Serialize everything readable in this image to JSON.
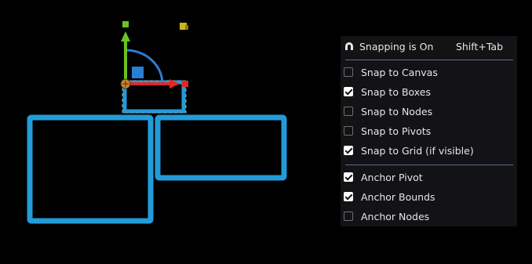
{
  "snap_menu": {
    "title": "Snapping is On",
    "shortcut": "Shift+Tab",
    "snap_items": [
      {
        "label": "Snap to Canvas",
        "checked": false
      },
      {
        "label": "Snap to Boxes",
        "checked": true
      },
      {
        "label": "Snap to Nodes",
        "checked": false
      },
      {
        "label": "Snap to Pivots",
        "checked": false
      },
      {
        "label": "Snap to Grid (if visible)",
        "checked": true
      }
    ],
    "anchor_items": [
      {
        "label": "Anchor Pivot",
        "checked": true
      },
      {
        "label": "Anchor Bounds",
        "checked": true
      },
      {
        "label": "Anchor Nodes",
        "checked": false
      }
    ]
  },
  "colors": {
    "canvas_background": "#000000",
    "box_stroke": "#229bd8",
    "gizmo_y_axis": "#6cc21d",
    "gizmo_x_axis": "#e02828",
    "gizmo_rotate": "#2a7fd4",
    "gizmo_corner_handle": "#c8b81b",
    "gizmo_pivot": "#c8842f",
    "panel_background": "#131316",
    "panel_separator": "#5a6d93"
  }
}
